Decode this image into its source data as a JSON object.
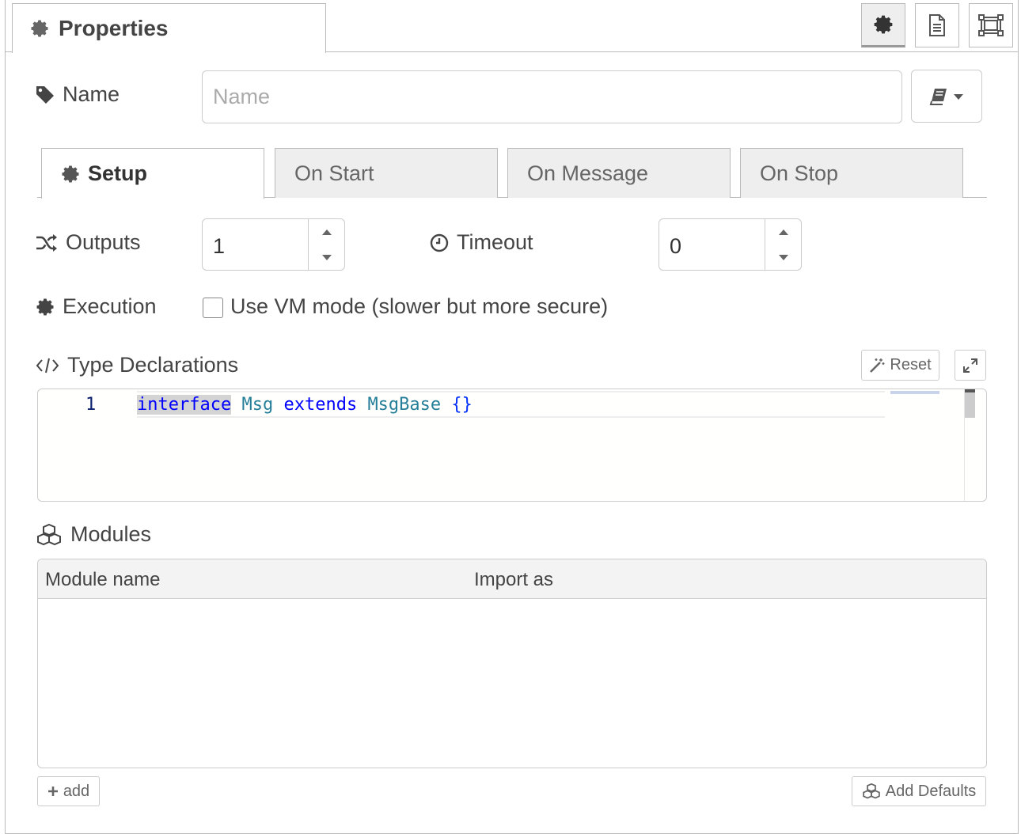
{
  "header": {
    "tab_label": "Properties",
    "tab_icon": "gear-icon",
    "buttons": [
      {
        "name": "settings-button",
        "icon": "gear-icon"
      },
      {
        "name": "description-button",
        "icon": "document-icon"
      },
      {
        "name": "appearance-button",
        "icon": "frame-icon"
      }
    ]
  },
  "name_field": {
    "label": "Name",
    "placeholder": "Name",
    "value": ""
  },
  "subtabs": [
    {
      "label": "Setup",
      "active": true
    },
    {
      "label": "On Start",
      "active": false
    },
    {
      "label": "On Message",
      "active": false
    },
    {
      "label": "On Stop",
      "active": false
    }
  ],
  "outputs": {
    "label": "Outputs",
    "value": "1"
  },
  "timeout": {
    "label": "Timeout",
    "value": "0"
  },
  "execution": {
    "label": "Execution",
    "checkbox_label": "Use VM mode (slower but more secure)",
    "checked": false
  },
  "type_declarations": {
    "label": "Type Declarations",
    "reset_label": "Reset",
    "line_number": "1",
    "code_tokens": [
      "interface",
      "Msg",
      "extends",
      "MsgBase",
      "{}"
    ]
  },
  "modules": {
    "label": "Modules",
    "columns": [
      "Module name",
      "Import as"
    ],
    "rows": [],
    "add_label": "add",
    "add_defaults_label": "Add Defaults"
  },
  "colors": {
    "border": "#bbbbbb",
    "keyword": "#0000ff",
    "type": "#267f99",
    "line_number": "#0b216f"
  }
}
